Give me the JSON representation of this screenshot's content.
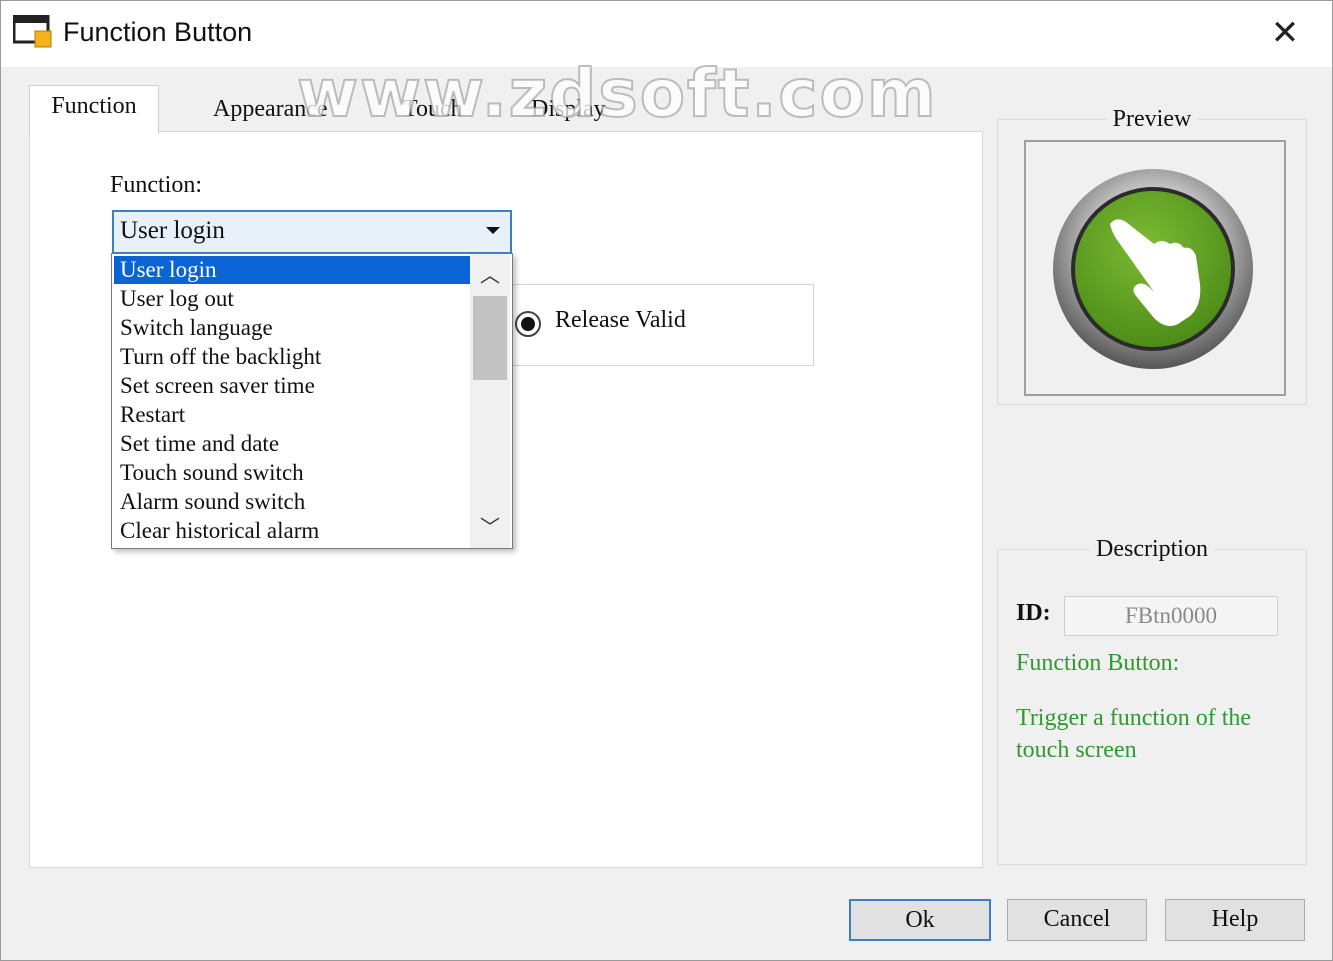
{
  "window": {
    "title": "Function Button",
    "close_glyph": "✕"
  },
  "watermark": "www.zdsoft.com",
  "tabs": [
    {
      "label": "Function",
      "active": true
    },
    {
      "label": "Appearance",
      "active": false
    },
    {
      "label": "Touch",
      "active": false
    },
    {
      "label": "Display",
      "active": false
    }
  ],
  "function_panel": {
    "function_label": "Function:",
    "selected_value": "User login",
    "release_label": "Release Valid",
    "release_checked": true
  },
  "dropdown": {
    "items": [
      "User login",
      "User log out",
      "Switch language",
      "Turn off the backlight",
      "Set screen saver time",
      "Restart",
      "Set time and date",
      "Touch sound switch",
      "Alarm sound switch",
      "Clear historical alarm"
    ],
    "selected_index": 0,
    "scroll_up_glyph": "︿",
    "scroll_down_glyph": "﹀"
  },
  "preview": {
    "title": "Preview",
    "icon": "hand-touch-icon",
    "button_color": "#5f9e22"
  },
  "description": {
    "title": "Description",
    "id_label": "ID:",
    "id_value": "FBtn0000",
    "type_title": "Function Button:",
    "text": "Trigger a function of the touch screen",
    "text_color": "#2f9a2f"
  },
  "buttons": {
    "ok": "Ok",
    "cancel": "Cancel",
    "help": "Help"
  }
}
